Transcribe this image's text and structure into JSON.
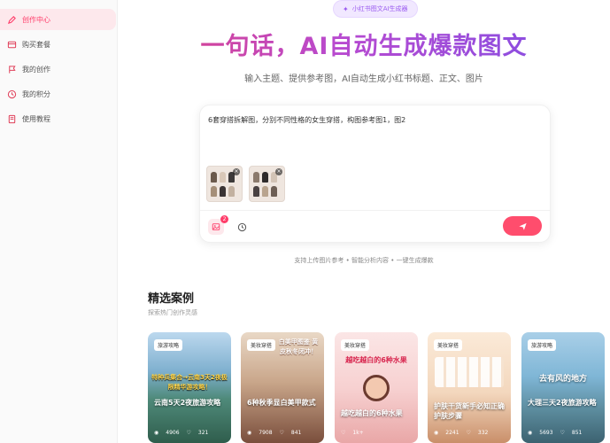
{
  "sidebar": {
    "items": [
      {
        "label": "创作中心",
        "icon": "pen-icon",
        "active": true
      },
      {
        "label": "购买套餐",
        "icon": "card-icon",
        "active": false
      },
      {
        "label": "我的创作",
        "icon": "flag-icon",
        "active": false
      },
      {
        "label": "我的积分",
        "icon": "clock-icon",
        "active": false
      },
      {
        "label": "使用教程",
        "icon": "book-icon",
        "active": false
      }
    ]
  },
  "header": {
    "pill": "小红书图文AI生成器",
    "headline": "一句话，AI自动生成爆款图文",
    "subline": "输入主题、提供参考图，AI自动生成小红书标题、正文、图片"
  },
  "composer": {
    "prompt": "6套穿搭拆解图，分别不同性格的女生穿搭，构图参考图1，图2",
    "image_count": "2"
  },
  "hints": "支持上传图片参考 • 智能分析内容 • 一键生成爆款",
  "featured": {
    "title": "精选案例",
    "subtitle": "探索热门创作灵感",
    "cards": [
      {
        "tag": "旅游攻略",
        "title": "云南5天2夜旅游攻略",
        "overlay": "特种兵集合→云南3天2夜极限精华游攻略！",
        "views": "4906",
        "likes": "321"
      },
      {
        "tag": "美妆穿搭",
        "title": "6种秋季显白美甲款式",
        "overlay": "白美甲图鉴 黄皮秋冬闭冲！",
        "views": "7908",
        "likes": "841"
      },
      {
        "tag": "美妆穿搭",
        "title": "越吃越白的6种水果",
        "overlay": "越吃越白的6种水果",
        "views": "",
        "likes": "1k+"
      },
      {
        "tag": "美妆穿搭",
        "title": "护肤干货新手必知正确护肤步骤",
        "overlay": "",
        "views": "2241",
        "likes": "332"
      },
      {
        "tag": "旅游攻略",
        "title": "大理三天2夜旅游攻略",
        "overlay": "去有风的地方",
        "views": "5693",
        "likes": "851"
      }
    ]
  }
}
